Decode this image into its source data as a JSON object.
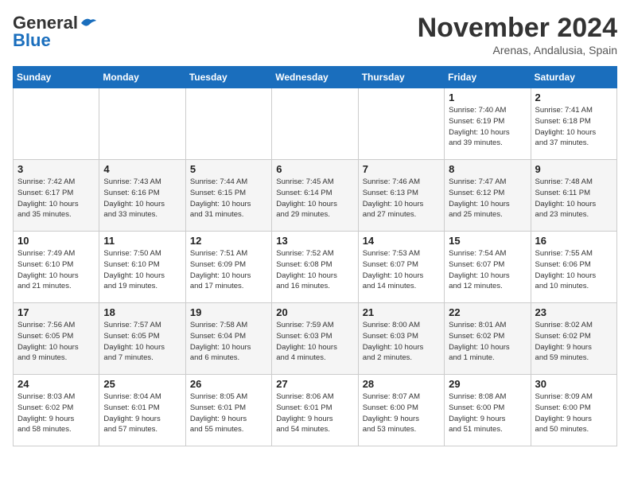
{
  "logo": {
    "line1": "General",
    "line2": "Blue"
  },
  "title": "November 2024",
  "subtitle": "Arenas, Andalusia, Spain",
  "headers": [
    "Sunday",
    "Monday",
    "Tuesday",
    "Wednesday",
    "Thursday",
    "Friday",
    "Saturday"
  ],
  "weeks": [
    [
      {
        "day": "",
        "info": ""
      },
      {
        "day": "",
        "info": ""
      },
      {
        "day": "",
        "info": ""
      },
      {
        "day": "",
        "info": ""
      },
      {
        "day": "",
        "info": ""
      },
      {
        "day": "1",
        "info": "Sunrise: 7:40 AM\nSunset: 6:19 PM\nDaylight: 10 hours\nand 39 minutes."
      },
      {
        "day": "2",
        "info": "Sunrise: 7:41 AM\nSunset: 6:18 PM\nDaylight: 10 hours\nand 37 minutes."
      }
    ],
    [
      {
        "day": "3",
        "info": "Sunrise: 7:42 AM\nSunset: 6:17 PM\nDaylight: 10 hours\nand 35 minutes."
      },
      {
        "day": "4",
        "info": "Sunrise: 7:43 AM\nSunset: 6:16 PM\nDaylight: 10 hours\nand 33 minutes."
      },
      {
        "day": "5",
        "info": "Sunrise: 7:44 AM\nSunset: 6:15 PM\nDaylight: 10 hours\nand 31 minutes."
      },
      {
        "day": "6",
        "info": "Sunrise: 7:45 AM\nSunset: 6:14 PM\nDaylight: 10 hours\nand 29 minutes."
      },
      {
        "day": "7",
        "info": "Sunrise: 7:46 AM\nSunset: 6:13 PM\nDaylight: 10 hours\nand 27 minutes."
      },
      {
        "day": "8",
        "info": "Sunrise: 7:47 AM\nSunset: 6:12 PM\nDaylight: 10 hours\nand 25 minutes."
      },
      {
        "day": "9",
        "info": "Sunrise: 7:48 AM\nSunset: 6:11 PM\nDaylight: 10 hours\nand 23 minutes."
      }
    ],
    [
      {
        "day": "10",
        "info": "Sunrise: 7:49 AM\nSunset: 6:10 PM\nDaylight: 10 hours\nand 21 minutes."
      },
      {
        "day": "11",
        "info": "Sunrise: 7:50 AM\nSunset: 6:10 PM\nDaylight: 10 hours\nand 19 minutes."
      },
      {
        "day": "12",
        "info": "Sunrise: 7:51 AM\nSunset: 6:09 PM\nDaylight: 10 hours\nand 17 minutes."
      },
      {
        "day": "13",
        "info": "Sunrise: 7:52 AM\nSunset: 6:08 PM\nDaylight: 10 hours\nand 16 minutes."
      },
      {
        "day": "14",
        "info": "Sunrise: 7:53 AM\nSunset: 6:07 PM\nDaylight: 10 hours\nand 14 minutes."
      },
      {
        "day": "15",
        "info": "Sunrise: 7:54 AM\nSunset: 6:07 PM\nDaylight: 10 hours\nand 12 minutes."
      },
      {
        "day": "16",
        "info": "Sunrise: 7:55 AM\nSunset: 6:06 PM\nDaylight: 10 hours\nand 10 minutes."
      }
    ],
    [
      {
        "day": "17",
        "info": "Sunrise: 7:56 AM\nSunset: 6:05 PM\nDaylight: 10 hours\nand 9 minutes."
      },
      {
        "day": "18",
        "info": "Sunrise: 7:57 AM\nSunset: 6:05 PM\nDaylight: 10 hours\nand 7 minutes."
      },
      {
        "day": "19",
        "info": "Sunrise: 7:58 AM\nSunset: 6:04 PM\nDaylight: 10 hours\nand 6 minutes."
      },
      {
        "day": "20",
        "info": "Sunrise: 7:59 AM\nSunset: 6:03 PM\nDaylight: 10 hours\nand 4 minutes."
      },
      {
        "day": "21",
        "info": "Sunrise: 8:00 AM\nSunset: 6:03 PM\nDaylight: 10 hours\nand 2 minutes."
      },
      {
        "day": "22",
        "info": "Sunrise: 8:01 AM\nSunset: 6:02 PM\nDaylight: 10 hours\nand 1 minute."
      },
      {
        "day": "23",
        "info": "Sunrise: 8:02 AM\nSunset: 6:02 PM\nDaylight: 9 hours\nand 59 minutes."
      }
    ],
    [
      {
        "day": "24",
        "info": "Sunrise: 8:03 AM\nSunset: 6:02 PM\nDaylight: 9 hours\nand 58 minutes."
      },
      {
        "day": "25",
        "info": "Sunrise: 8:04 AM\nSunset: 6:01 PM\nDaylight: 9 hours\nand 57 minutes."
      },
      {
        "day": "26",
        "info": "Sunrise: 8:05 AM\nSunset: 6:01 PM\nDaylight: 9 hours\nand 55 minutes."
      },
      {
        "day": "27",
        "info": "Sunrise: 8:06 AM\nSunset: 6:01 PM\nDaylight: 9 hours\nand 54 minutes."
      },
      {
        "day": "28",
        "info": "Sunrise: 8:07 AM\nSunset: 6:00 PM\nDaylight: 9 hours\nand 53 minutes."
      },
      {
        "day": "29",
        "info": "Sunrise: 8:08 AM\nSunset: 6:00 PM\nDaylight: 9 hours\nand 51 minutes."
      },
      {
        "day": "30",
        "info": "Sunrise: 8:09 AM\nSunset: 6:00 PM\nDaylight: 9 hours\nand 50 minutes."
      }
    ]
  ]
}
